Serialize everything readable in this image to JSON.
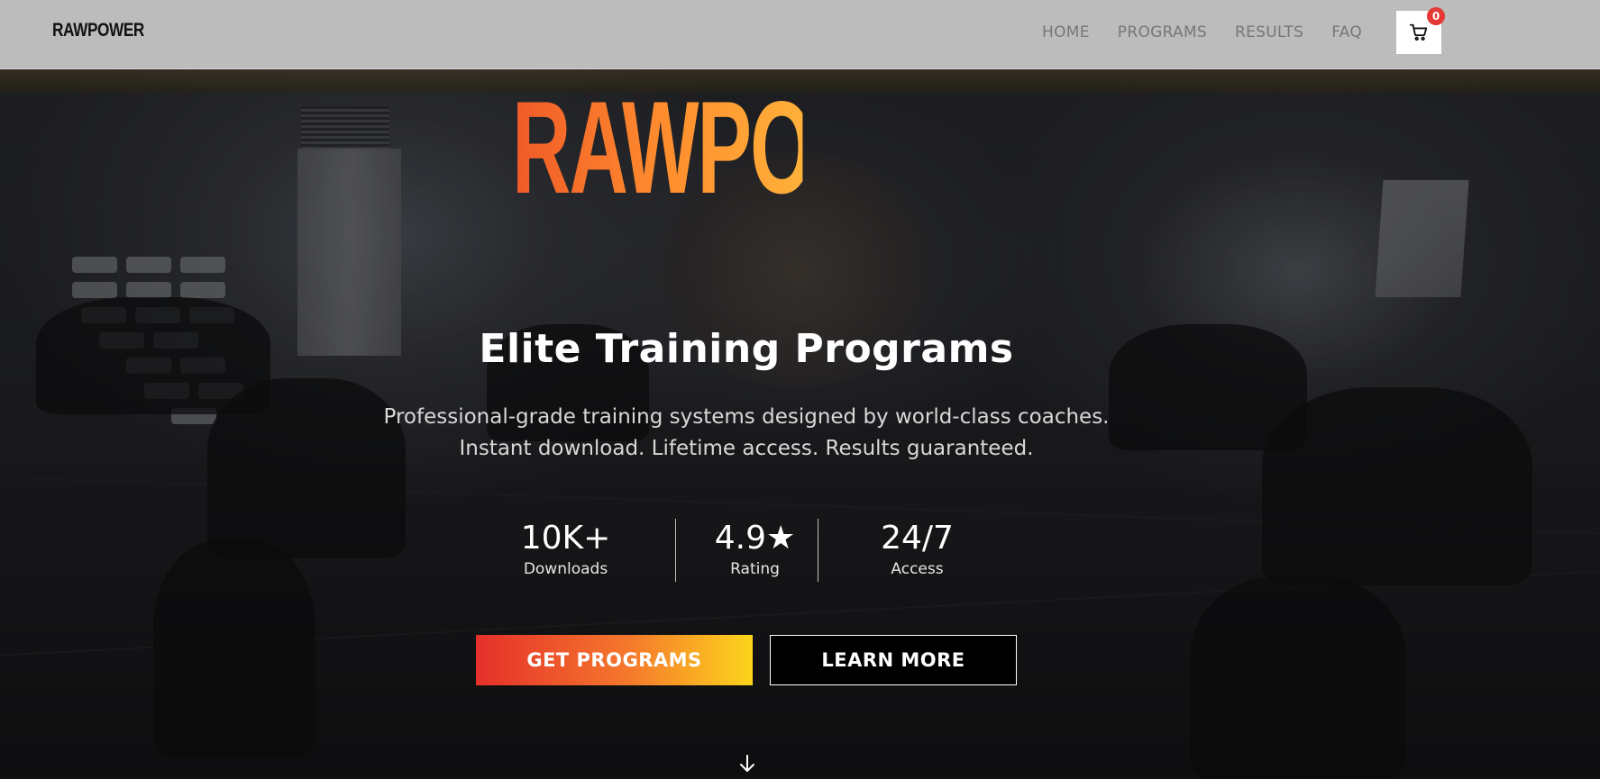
{
  "nav": {
    "logo": "RAWPOWER",
    "links": [
      "HOME",
      "PROGRAMS",
      "RESULTS",
      "FAQ"
    ],
    "cart_icon": "cart-icon",
    "cart_count": "0"
  },
  "hero": {
    "title": "RAWPOWER",
    "subtitle": "Elite Training Programs",
    "description_line1": "Professional-grade training systems designed by world-class coaches.",
    "description_line2": "Instant download. Lifetime access. Results guaranteed.",
    "stats": [
      {
        "value": "10K+",
        "label": "Downloads"
      },
      {
        "value": "4.9★",
        "label": "Rating"
      },
      {
        "value": "24/7",
        "label": "Access"
      }
    ],
    "primary_button": "GET PROGRAMS",
    "secondary_button": "LEARN MORE",
    "scroll_icon": "arrow-down-icon"
  },
  "colors": {
    "accent_start": "#e5302a",
    "accent_end": "#fdd51c",
    "title_gradient_start": "#f05a28",
    "title_gradient_end": "#ffb03a",
    "badge": "#e53935"
  }
}
